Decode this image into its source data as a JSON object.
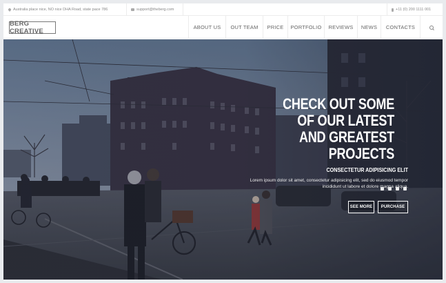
{
  "topbar": {
    "address": "Australia place nice, NO nice DHA Road, state pace 786",
    "email": "support@theberg.com",
    "phone": "+11 (0) 200 1111 001",
    "icons": [
      "map-pin-icon",
      "envelope-icon",
      "phone-icon"
    ]
  },
  "header": {
    "logo": "BERG CREATIVE",
    "nav": [
      "ABOUT US",
      "OUT TEAM",
      "PRICE",
      "PORTFOLIO",
      "REVIEWS",
      "NEWS",
      "CONTACTS"
    ],
    "search_icon": "search-icon"
  },
  "hero": {
    "headline": "CHECK OUT SOME OF OUR LATEST AND GREATEST PROJECTS",
    "subheading": "CONSECTETUR ADIPISICING ELIT",
    "body": "Lorem ipsum dolor sit amet, consectetur adipisicing elit, sed do eiusmod tempor incididunt ut labore et dolore magna aliqua.",
    "social_icons": [
      "flickr-icon",
      "facebook-icon",
      "pinterest-icon",
      "twitter-icon"
    ],
    "buttons": {
      "see_more": "SEE MORE",
      "purchase": "PURCHASE"
    }
  },
  "colors": {
    "accent": "#ffffff",
    "overlay": "#2a2f3a"
  }
}
